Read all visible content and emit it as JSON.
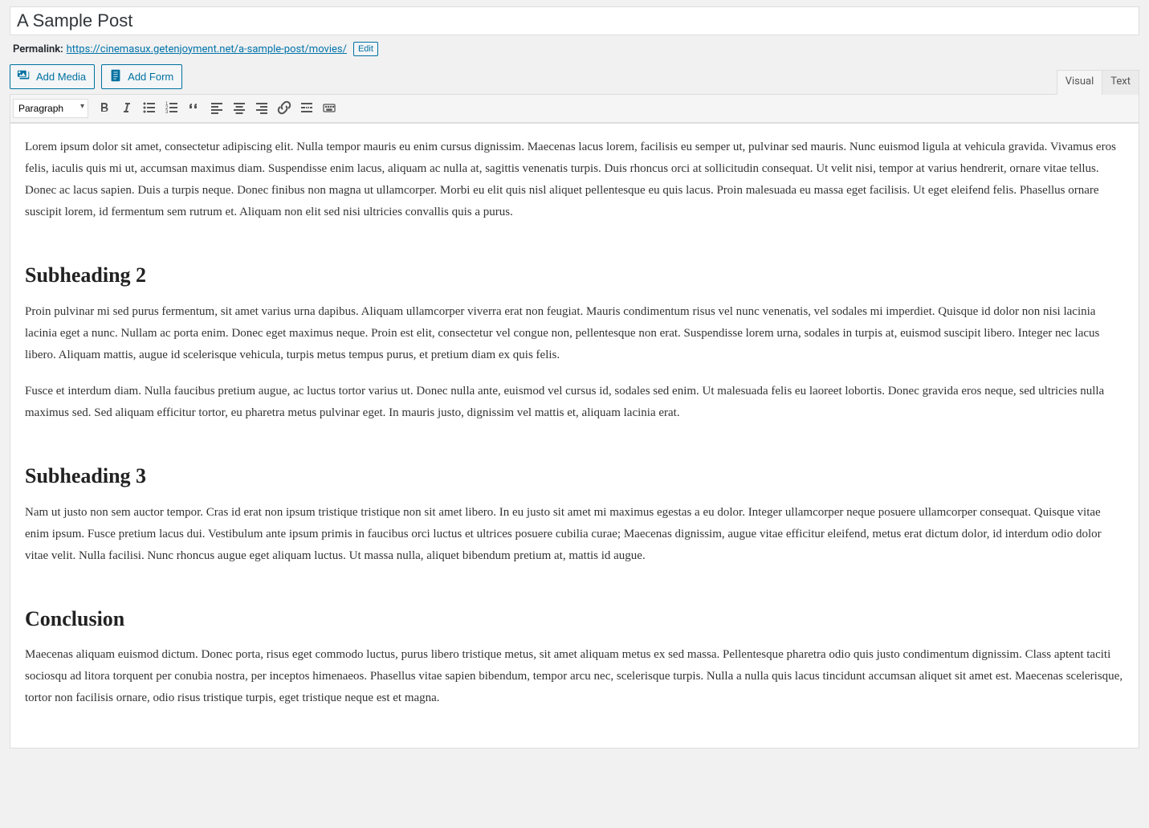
{
  "post": {
    "title": "A Sample Post"
  },
  "permalink": {
    "label": "Permalink:",
    "url": "https://cinemasux.getenjoyment.net/a-sample-post/movies/",
    "edit_label": "Edit"
  },
  "buttons": {
    "add_media": "Add Media",
    "add_form": "Add Form"
  },
  "tabs": {
    "visual": "Visual",
    "text": "Text"
  },
  "toolbar": {
    "format_select": "Paragraph"
  },
  "content": {
    "p1": "Lorem ipsum dolor sit amet, consectetur adipiscing elit. Nulla tempor mauris eu enim cursus dignissim. Maecenas lacus lorem, facilisis eu semper ut, pulvinar sed mauris. Nunc euismod ligula at vehicula gravida. Vivamus eros felis, iaculis quis mi ut, accumsan maximus diam. Suspendisse enim lacus, aliquam ac nulla at, sagittis venenatis turpis. Duis rhoncus orci at sollicitudin consequat. Ut velit nisi, tempor at varius hendrerit, ornare vitae tellus. Donec ac lacus sapien. Duis a turpis neque. Donec finibus non magna ut ullamcorper. Morbi eu elit quis nisl aliquet pellentesque eu quis lacus. Proin malesuada eu massa eget facilisis. Ut eget eleifend felis. Phasellus ornare suscipit lorem, id fermentum sem rutrum et. Aliquam non elit sed nisi ultricies convallis quis a purus.",
    "h2_1": "Subheading 2",
    "p2": "Proin pulvinar mi sed purus fermentum, sit amet varius urna dapibus. Aliquam ullamcorper viverra erat non feugiat. Mauris condimentum risus vel nunc venenatis, vel sodales mi imperdiet. Quisque id dolor non nisi lacinia lacinia eget a nunc. Nullam ac porta enim. Donec eget maximus neque. Proin est elit, consectetur vel congue non, pellentesque non erat. Suspendisse lorem urna, sodales in turpis at, euismod suscipit libero. Integer nec lacus libero. Aliquam mattis, augue id scelerisque vehicula, turpis metus tempus purus, et pretium diam ex quis felis.",
    "p3": "Fusce et interdum diam. Nulla faucibus pretium augue, ac luctus tortor varius ut. Donec nulla ante, euismod vel cursus id, sodales sed enim. Ut malesuada felis eu laoreet lobortis. Donec gravida eros neque, sed ultricies nulla maximus sed. Sed aliquam efficitur tortor, eu pharetra metus pulvinar eget. In mauris justo, dignissim vel mattis et, aliquam lacinia erat.",
    "h2_2": "Subheading 3",
    "p4": "Nam ut justo non sem auctor tempor. Cras id erat non ipsum tristique tristique non sit amet libero. In eu justo sit amet mi maximus egestas a eu dolor. Integer ullamcorper neque posuere ullamcorper consequat. Quisque vitae enim ipsum. Fusce pretium lacus dui. Vestibulum ante ipsum primis in faucibus orci luctus et ultrices posuere cubilia curae; Maecenas dignissim, augue vitae efficitur eleifend, metus erat dictum dolor, id interdum odio dolor vitae velit. Nulla facilisi. Nunc rhoncus augue eget aliquam luctus. Ut massa nulla, aliquet bibendum pretium at, mattis id augue.",
    "h2_3": "Conclusion",
    "p5": "Maecenas aliquam euismod dictum. Donec porta, risus eget commodo luctus, purus libero tristique metus, sit amet aliquam metus ex sed massa. Pellentesque pharetra odio quis justo condimentum dignissim. Class aptent taciti sociosqu ad litora torquent per conubia nostra, per inceptos himenaeos. Phasellus vitae sapien bibendum, tempor arcu nec, scelerisque turpis. Nulla a nulla quis lacus tincidunt accumsan aliquet sit amet est. Maecenas scelerisque, tortor non facilisis ornare, odio risus tristique turpis, eget tristique neque est et magna."
  }
}
